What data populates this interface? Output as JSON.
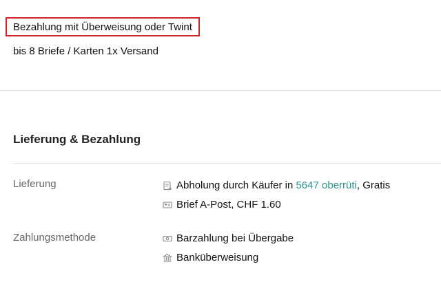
{
  "payment_highlight": "Bezahlung mit Überweisung oder Twint",
  "shipping_note": "bis 8 Briefe / Karten 1x Versand",
  "section": {
    "title": "Lieferung & Bezahlung"
  },
  "delivery": {
    "label": "Lieferung",
    "pickup_prefix": "Abholung durch Käufer in",
    "pickup_location": "5647 oberrüti",
    "pickup_suffix": ", Gratis",
    "post_option": "Brief A-Post, CHF 1.60",
    "icons": [
      "pickup-icon",
      "envelope-icon"
    ]
  },
  "payment": {
    "label": "Zahlungsmethode",
    "cash": "Barzahlung bei Übergabe",
    "bank": "Banküberweisung",
    "icons": [
      "cash-icon",
      "bank-icon"
    ]
  }
}
